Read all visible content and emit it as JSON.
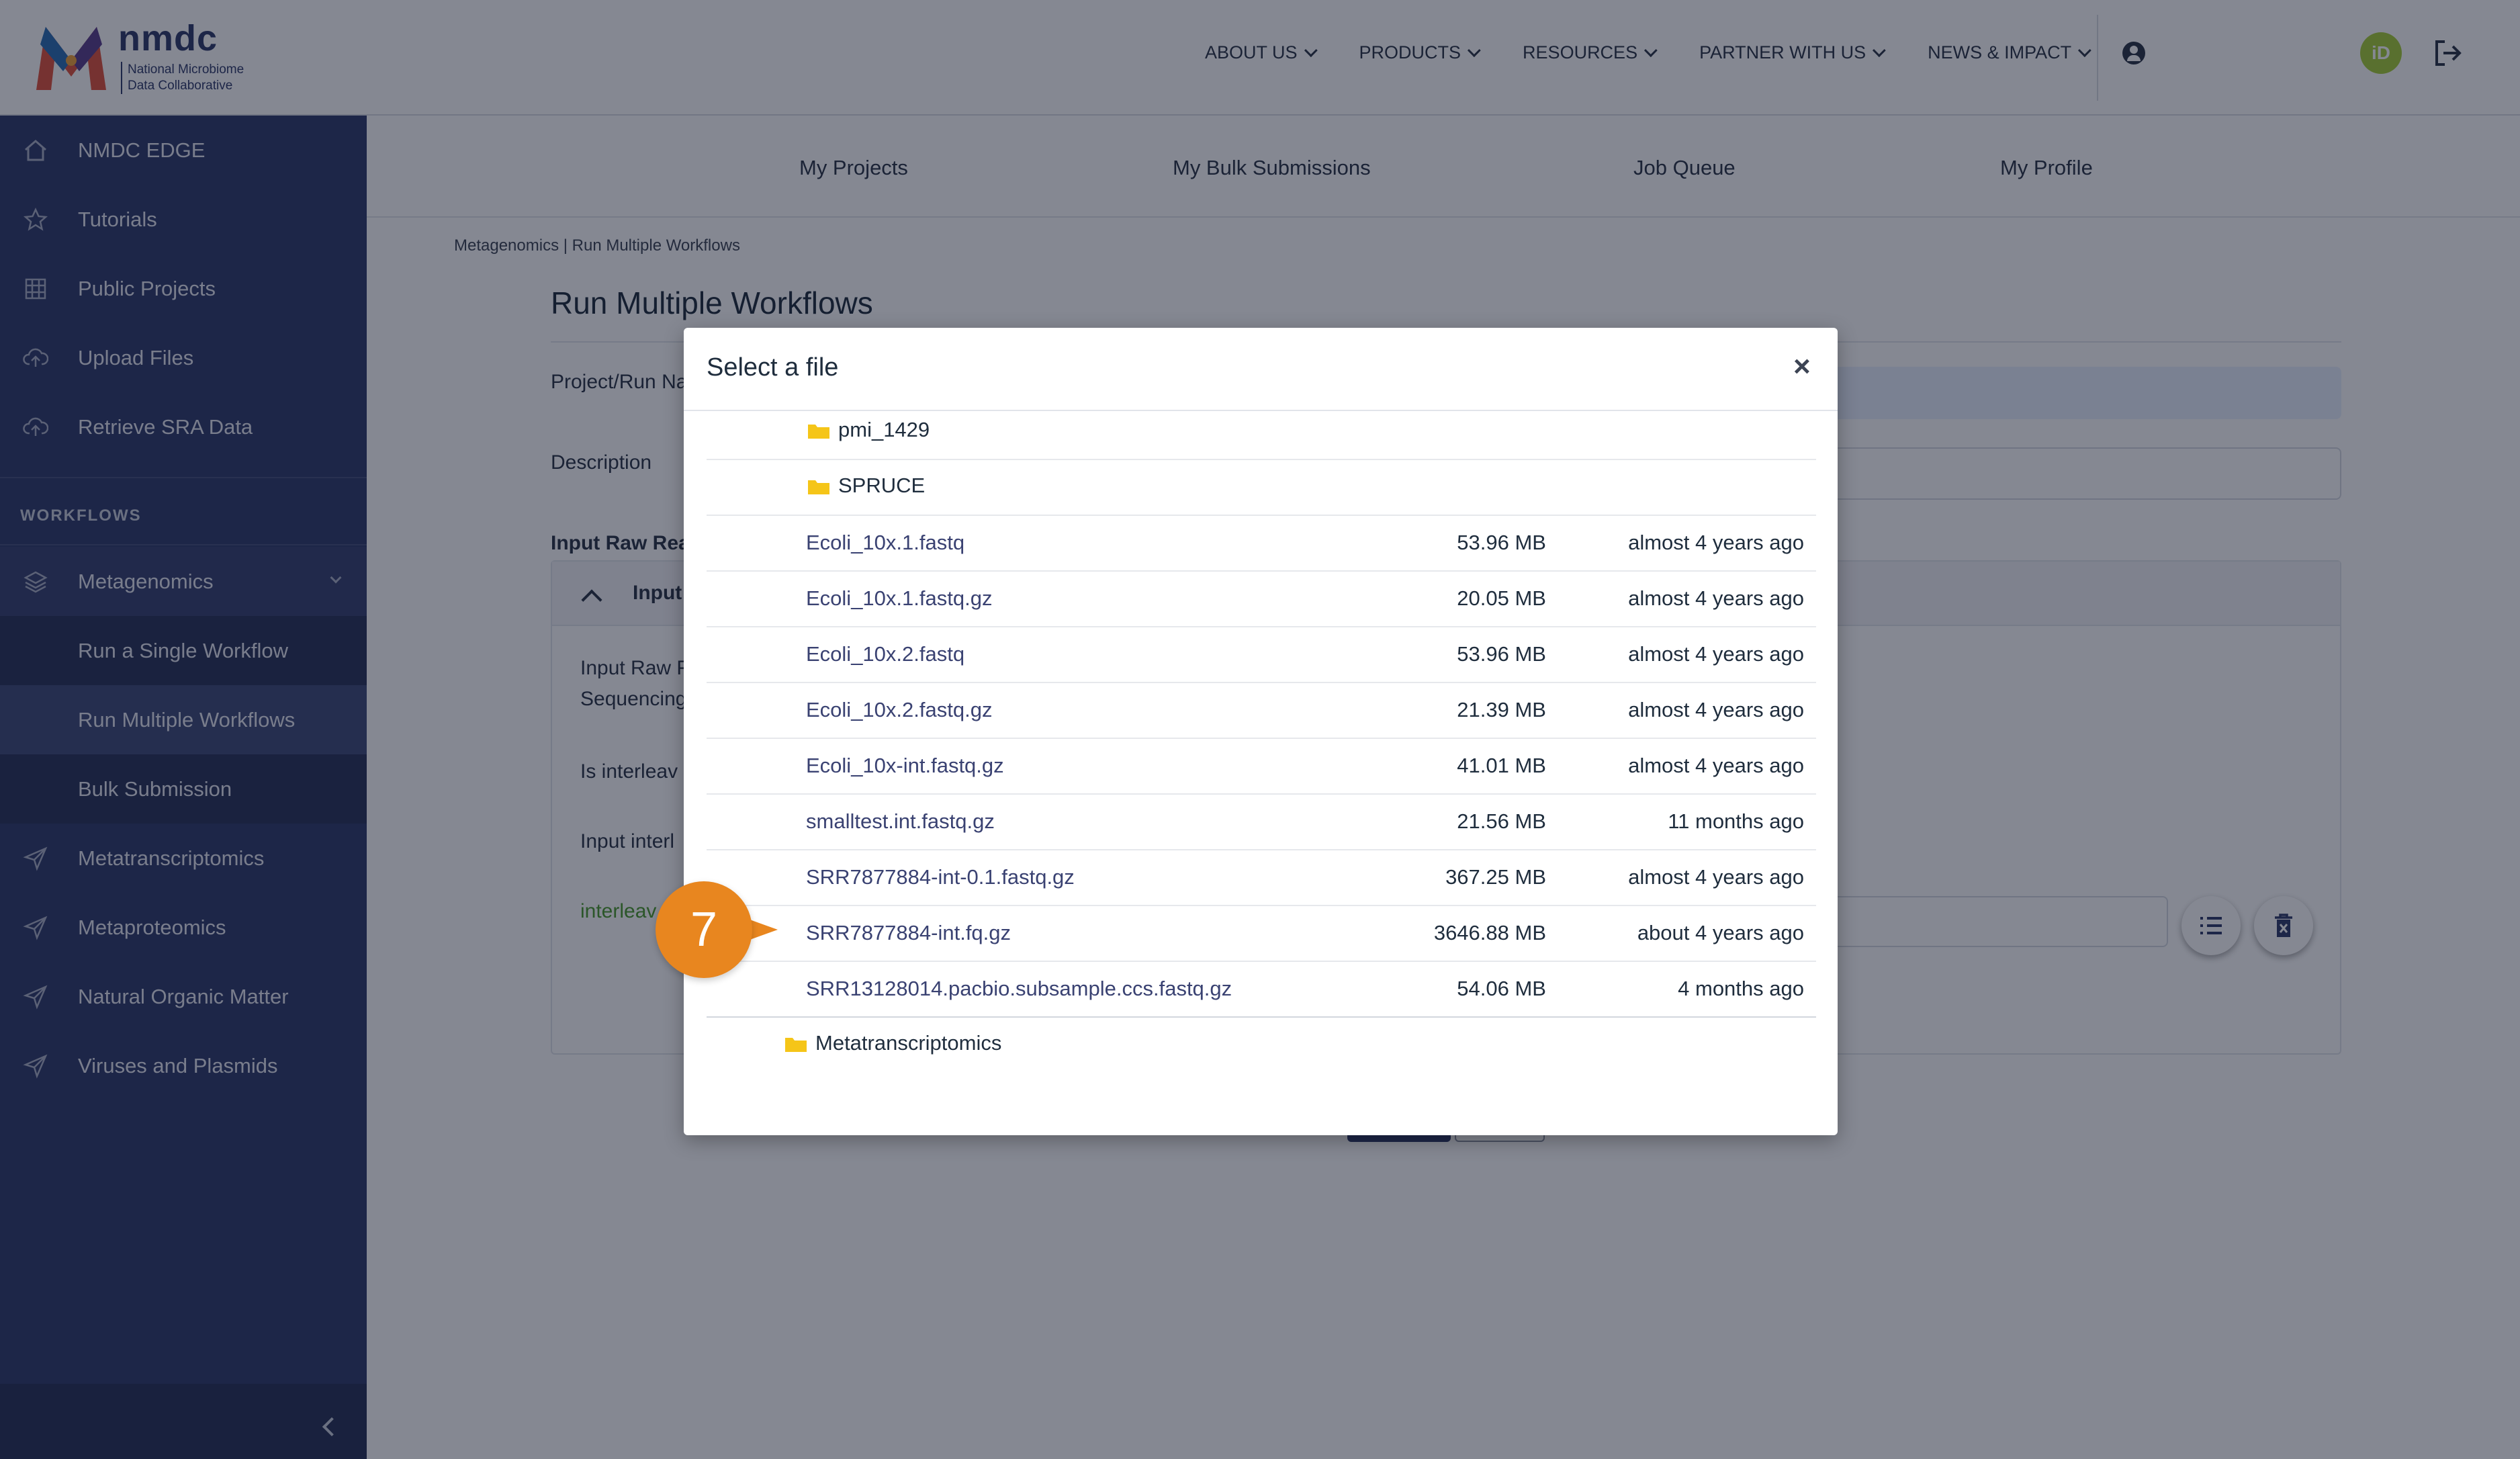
{
  "header": {
    "logo_title": "nmdc",
    "logo_subtitle": "National Microbiome Data Collaborative",
    "nav": [
      {
        "label": "ABOUT US"
      },
      {
        "label": "PRODUCTS"
      },
      {
        "label": "RESOURCES"
      },
      {
        "label": "PARTNER WITH US"
      },
      {
        "label": "NEWS & IMPACT"
      }
    ],
    "orcid_label": "iD"
  },
  "sidebar": {
    "items": [
      {
        "label": "NMDC EDGE"
      },
      {
        "label": "Tutorials"
      },
      {
        "label": "Public Projects"
      },
      {
        "label": "Upload Files"
      },
      {
        "label": "Retrieve SRA Data"
      }
    ],
    "section_title": "WORKFLOWS",
    "workflows": [
      {
        "label": "Metagenomics"
      },
      {
        "label": "Run a Single Workflow"
      },
      {
        "label": "Run Multiple Workflows"
      },
      {
        "label": "Bulk Submission"
      },
      {
        "label": "Metatranscriptomics"
      },
      {
        "label": "Metaproteomics"
      },
      {
        "label": "Natural Organic Matter"
      },
      {
        "label": "Viruses and Plasmids"
      }
    ]
  },
  "subnav": [
    {
      "label": "My Projects"
    },
    {
      "label": "My Bulk Submissions"
    },
    {
      "label": "Job Queue"
    },
    {
      "label": "My Profile"
    }
  ],
  "page": {
    "breadcrumb": "Metagenomics | Run Multiple Workflows",
    "title": "Run Multiple Workflows",
    "project_label": "Project/Run Na",
    "description_label": "Description",
    "input_raw_label": "Input Raw Rea",
    "panel_title": "Input",
    "input_raw_line1": "Input Raw F",
    "input_raw_line2": "Sequencing",
    "interleaved_label": "Is interleav",
    "input_interl_label": "Input interl",
    "green_label": "interleav"
  },
  "modal": {
    "title": "Select a file",
    "close": "×",
    "rows": [
      {
        "kind": "folder",
        "name": "pmi_1429"
      },
      {
        "kind": "folder",
        "name": "SPRUCE"
      },
      {
        "kind": "file",
        "name": "Ecoli_10x.1.fastq",
        "size": "53.96 MB",
        "date": "almost 4 years ago"
      },
      {
        "kind": "file",
        "name": "Ecoli_10x.1.fastq.gz",
        "size": "20.05 MB",
        "date": "almost 4 years ago"
      },
      {
        "kind": "file",
        "name": "Ecoli_10x.2.fastq",
        "size": "53.96 MB",
        "date": "almost 4 years ago"
      },
      {
        "kind": "file",
        "name": "Ecoli_10x.2.fastq.gz",
        "size": "21.39 MB",
        "date": "almost 4 years ago"
      },
      {
        "kind": "file",
        "name": "Ecoli_10x-int.fastq.gz",
        "size": "41.01 MB",
        "date": "almost 4 years ago"
      },
      {
        "kind": "file",
        "name": "smalltest.int.fastq.gz",
        "size": "21.56 MB",
        "date": "11 months ago"
      },
      {
        "kind": "file",
        "name": "SRR7877884-int-0.1.fastq.gz",
        "size": "367.25 MB",
        "date": "almost 4 years ago"
      },
      {
        "kind": "file",
        "name": "SRR7877884-int.fq.gz",
        "size": "3646.88 MB",
        "date": "about 4 years ago"
      },
      {
        "kind": "file",
        "name": "SRR13128014.pacbio.subsample.ccs.fastq.gz",
        "size": "54.06 MB",
        "date": "4 months ago"
      }
    ],
    "parent_folder": "Metatranscriptomics"
  },
  "step_badge": "7",
  "colors": {
    "sidebar": "#2f3a6a",
    "accent_orange": "#e8861f",
    "folder": "#f5c518",
    "link": "#3a4272",
    "green": "#4a9a2c"
  }
}
